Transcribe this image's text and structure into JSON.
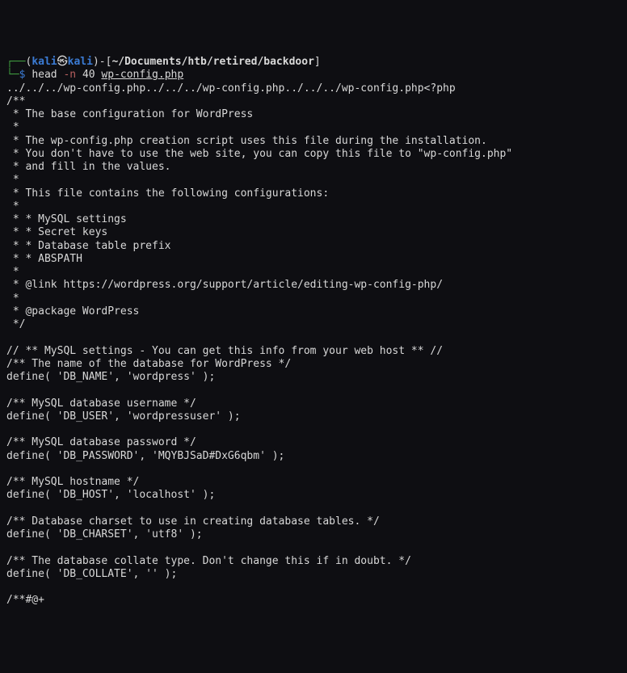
{
  "prompt": {
    "box_top": "┌──",
    "paren_open": "(",
    "user": "kali",
    "skull": "㉿",
    "host": "kali",
    "paren_close": ")",
    "dash": "-",
    "bracket_open": "[",
    "path": "~/Documents/htb/retired/backdoor",
    "bracket_close": "]",
    "box_bottom": "└─",
    "dollar": "$",
    "command": "head",
    "flag": "-n",
    "num": "40",
    "arg": "wp-config.php"
  },
  "output": "../../../wp-config.php../../../wp-config.php../../../wp-config.php<?php\n/**\n * The base configuration for WordPress\n *\n * The wp-config.php creation script uses this file during the installation.\n * You don't have to use the web site, you can copy this file to \"wp-config.php\"\n * and fill in the values.\n *\n * This file contains the following configurations:\n *\n * * MySQL settings\n * * Secret keys\n * * Database table prefix\n * * ABSPATH\n *\n * @link https://wordpress.org/support/article/editing-wp-config-php/\n *\n * @package WordPress\n */\n\n// ** MySQL settings - You can get this info from your web host ** //\n/** The name of the database for WordPress */\ndefine( 'DB_NAME', 'wordpress' );\n\n/** MySQL database username */\ndefine( 'DB_USER', 'wordpressuser' );\n\n/** MySQL database password */\ndefine( 'DB_PASSWORD', 'MQYBJSaD#DxG6qbm' );\n\n/** MySQL hostname */\ndefine( 'DB_HOST', 'localhost' );\n\n/** Database charset to use in creating database tables. */\ndefine( 'DB_CHARSET', 'utf8' );\n\n/** The database collate type. Don't change this if in doubt. */\ndefine( 'DB_COLLATE', '' );\n\n/**#@+"
}
